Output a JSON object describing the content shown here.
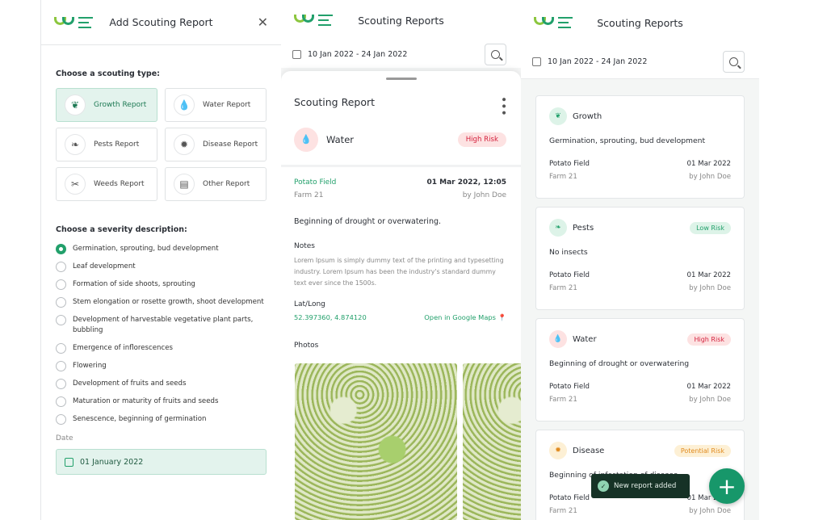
{
  "add": {
    "title": "Add Scouting Report",
    "type_heading": "Choose a scouting type:",
    "types": [
      {
        "label": "Growth Report",
        "icon": "growth-icon"
      },
      {
        "label": "Water Report",
        "icon": "water-drops-icon"
      },
      {
        "label": "Pests Report",
        "icon": "pest-icon"
      },
      {
        "label": "Disease Report",
        "icon": "disease-icon"
      },
      {
        "label": "Weeds Report",
        "icon": "weeds-icon"
      },
      {
        "label": "Other Report",
        "icon": "document-icon"
      }
    ],
    "selected_type": "Growth Report",
    "severity_heading": "Choose a severity description:",
    "severities": [
      "Germination, sprouting, bud development",
      "Leaf development",
      "Formation of side shoots, sprouting",
      "Stem elongation or rosette growth, shoot development",
      "Development of harvestable vegetative plant parts, bubbling",
      "Emergence of inflorescences",
      "Flowering",
      "Development of fruits and seeds",
      "Maturation or maturity of fruits and seeds",
      "Senescence, beginning of germination"
    ],
    "selected_severity": 0,
    "date_label": "Date",
    "date_value": "01 January 2022"
  },
  "list_title": "Scouting Reports",
  "date_range": "10 Jan 2022 - 24 Jan 2022",
  "detail": {
    "title": "Scouting Report",
    "type": "Water",
    "risk": "High Risk",
    "field": "Potato Field",
    "farm": "Farm 21",
    "datetime": "01 Mar 2022, 12:05",
    "author": "by John Doe",
    "description": "Beginning of drought or overwatering.",
    "notes_label": "Notes",
    "notes": "Lorem Ipsum is simply dummy text of the printing and typesetting industry. Lorem Ipsum has been the industry's standard dummy text ever since the 1500s.",
    "latlong_label": "Lat/Long",
    "latlong": "52.397360, 4.874120",
    "maps_link": "Open in Google Maps",
    "photos_label": "Photos"
  },
  "cards": [
    {
      "type": "Growth",
      "risk": "",
      "description": "Germination, sprouting, bud development",
      "field": "Potato Field",
      "farm": "Farm 21",
      "date": "01 Mar 2022",
      "author": "by John Doe",
      "color": "#22a06b"
    },
    {
      "type": "Pests",
      "risk": "Low Risk",
      "description": "No insects",
      "field": "Potato Field",
      "farm": "Farm 21",
      "date": "01 Mar 2022",
      "author": "by John Doe",
      "color": "#22a06b"
    },
    {
      "type": "Water",
      "risk": "High Risk",
      "description": "Beginning of drought or overwatering",
      "field": "Potato Field",
      "farm": "Farm 21",
      "date": "01 Mar 2022",
      "author": "by John Doe",
      "color": "#d4213d"
    },
    {
      "type": "Disease",
      "risk": "Potential Risk",
      "description": "Beginning of infestation of disease",
      "field": "Potato Field",
      "farm": "Farm 21",
      "date": "01 Mar 2022",
      "author": "by John Doe",
      "color": "#e08a1e"
    }
  ],
  "toast": "New report added",
  "fab_label": "+",
  "colors": {
    "primary": "#22a06b",
    "high": "#d4213d",
    "potential": "#e08a1e"
  }
}
